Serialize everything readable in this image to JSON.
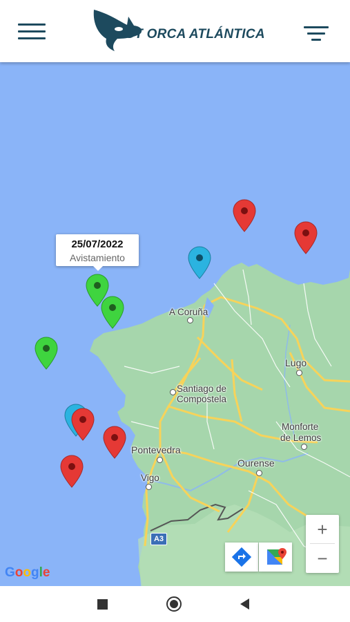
{
  "header": {
    "brand": "GT ORCA ATLÁNTICA",
    "menu_icon": "hamburger-menu-icon",
    "filter_icon": "filter-icon"
  },
  "map": {
    "places": {
      "a_coruna": "A Coruña",
      "lugo": "Lugo",
      "santiago_line1": "Santiago de",
      "santiago_line2": "Compostela",
      "monforte_line1": "Monforte",
      "monforte_line2": "de Lemos",
      "pontevedra": "Pontevedra",
      "ourense": "Ourense",
      "vigo": "Vigo",
      "road_a3": "A3"
    },
    "tooltip": {
      "date": "25/07/2022",
      "type": "Avistamiento"
    },
    "attribution": "Google",
    "zoom_in": "+",
    "zoom_out": "−",
    "marker_colors": {
      "red": "#e53935",
      "green": "#3fd43f",
      "blue": "#2bb3e0"
    }
  },
  "colors": {
    "brand": "#1d4a5e",
    "sea": "#8ab4f8",
    "land": "#a6d6ac"
  }
}
